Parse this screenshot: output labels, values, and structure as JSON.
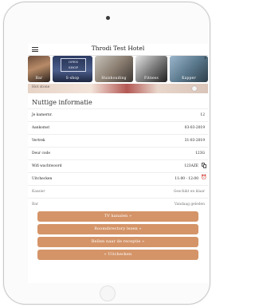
{
  "header": {
    "title": "Throdi Test Hotel"
  },
  "tiles": [
    {
      "label": "Bar"
    },
    {
      "label": "S-shop",
      "sign_text": "OPEN\nSHOP"
    },
    {
      "label": "Huishouding"
    },
    {
      "label": "Fitness"
    },
    {
      "label": "Kapper"
    }
  ],
  "banner": {
    "label": "Hot stone"
  },
  "info": {
    "section_title": "Nuttige informatie",
    "rows": [
      {
        "label": "Je kamernr.",
        "value": "12"
      },
      {
        "label": "Aankomst",
        "value": "03-03-2019"
      },
      {
        "label": "Vertrek",
        "value": "31-03-2019"
      },
      {
        "label": "Deur code",
        "value": "123G"
      },
      {
        "label": "Wifi wachtwoord",
        "value": "123AZE"
      },
      {
        "label": "Uitchecken",
        "value": "11:00 - 12:00"
      },
      {
        "label": "Kassier",
        "value": "Geschikt en klaar"
      },
      {
        "label": "Bar",
        "value": "Vandaag geleden"
      }
    ]
  },
  "buttons": {
    "tv": "TV kanalen »",
    "room_directory": "Roomdirectory lezen »",
    "call_reception": "Bellen naar de receptie »",
    "checkout": "« Uitchecken"
  },
  "colors": {
    "button": "#d49468",
    "background": "#ffffff"
  }
}
